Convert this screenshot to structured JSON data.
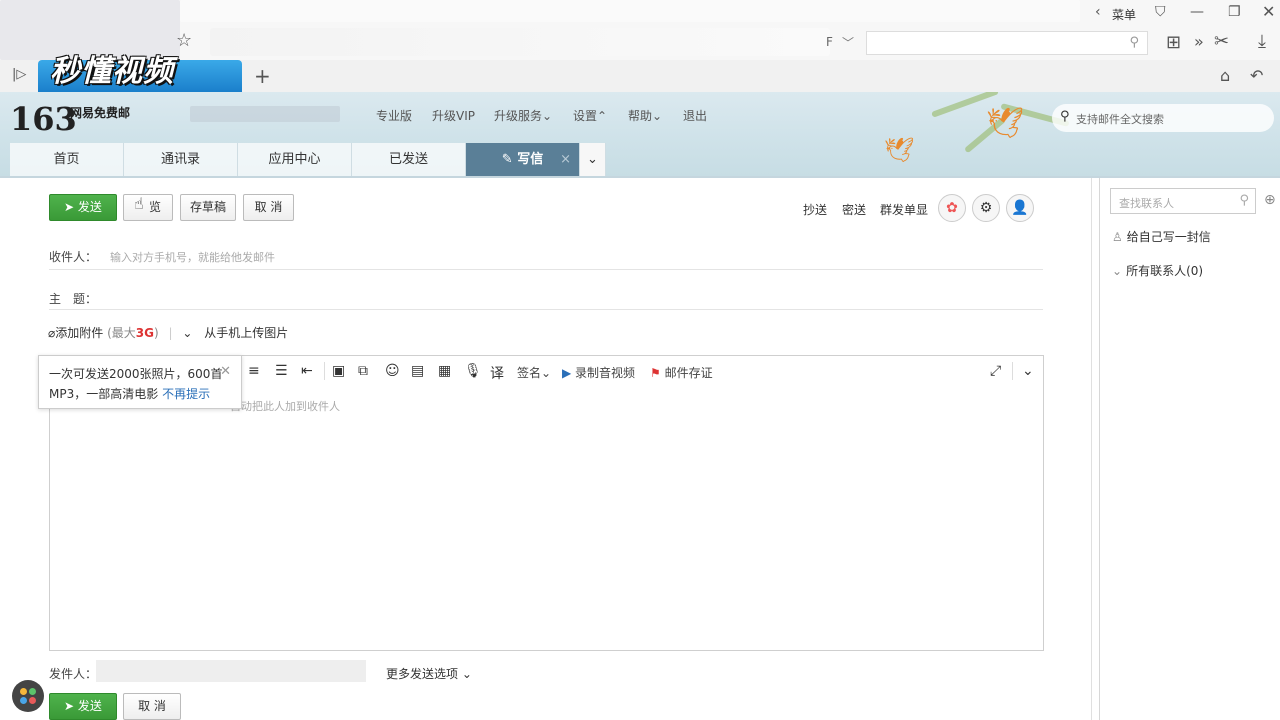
{
  "browser": {
    "menu_label": "菜单",
    "logo_text": "秒懂视频",
    "new_tab": "+",
    "address_partial": "F"
  },
  "mail": {
    "brand_number": "163",
    "brand_name": "网易免费邮",
    "top_nav": [
      "专业版",
      "升级VIP",
      "升级服务",
      "设置",
      "帮助",
      "退出"
    ],
    "search_placeholder": "支持邮件全文搜索",
    "tabs": [
      "首页",
      "通讯录",
      "应用中心",
      "已发送",
      "写信"
    ]
  },
  "compose": {
    "send": "发送",
    "preview": "览",
    "save_draft": "存草稿",
    "cancel": "取 消",
    "cc": "抄送",
    "bcc": "密送",
    "group_single": "群发单显",
    "recipient_label": "收件人：",
    "recipient_placeholder": "输入对方手机号，就能给他发邮件",
    "subject_label": "主　题：",
    "attach_label": "添加附件",
    "attach_max_prefix": "(最大",
    "attach_max_value": "3G",
    "attach_max_suffix": ")",
    "upload_phone": "从手机上传图片",
    "toolbar": {
      "signature": "签名",
      "record_video": "录制音视频",
      "mail_evidence": "邮件存证"
    },
    "editor_hint": "自动把此人加到收件人",
    "tooltip_line1": "一次可发送2000张照片，600首",
    "tooltip_line2": "MP3，一部高清电影",
    "tooltip_link": "不再提示",
    "sender_label": "发件人：",
    "more_options": "更多发送选项",
    "bottom_send": "发送",
    "bottom_cancel": "取 消"
  },
  "contacts": {
    "search_placeholder": "查找联系人",
    "write_self": "给自己写一封信",
    "all_contacts": "所有联系人(0)"
  },
  "colors": {
    "send_green": "#3a9a37",
    "active_tab": "#5a7f97",
    "link_blue": "#2a6fb8",
    "attach_red": "#d33333"
  }
}
